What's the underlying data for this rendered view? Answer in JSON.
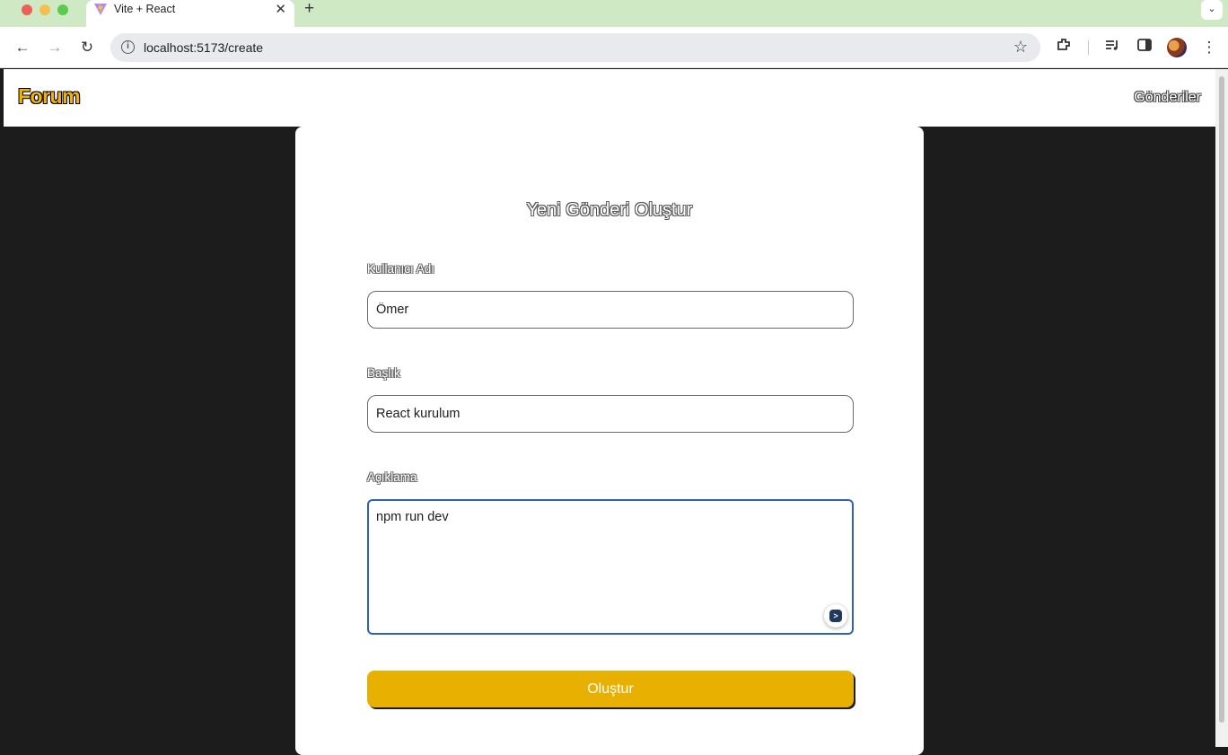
{
  "browser": {
    "tab_title": "Vite + React",
    "new_tab": "+",
    "close_tab": "✕",
    "url": "localhost:5173/create"
  },
  "navbar": {
    "brand": "Forum",
    "posts_link": "Gönderiler"
  },
  "form": {
    "title": "Yeni Gönderi Oluştur",
    "username_label": "Kullanıcı Adı",
    "username_value": "Ömer",
    "title_label": "Başlık",
    "title_value": "React kurulum",
    "description_label": "Açıklama",
    "description_value": "npm run dev",
    "submit_label": "Oluştur"
  },
  "colors": {
    "accent": "#e8b000",
    "page_bg": "#1c1c1c",
    "focus_border": "#2f5fbf"
  }
}
